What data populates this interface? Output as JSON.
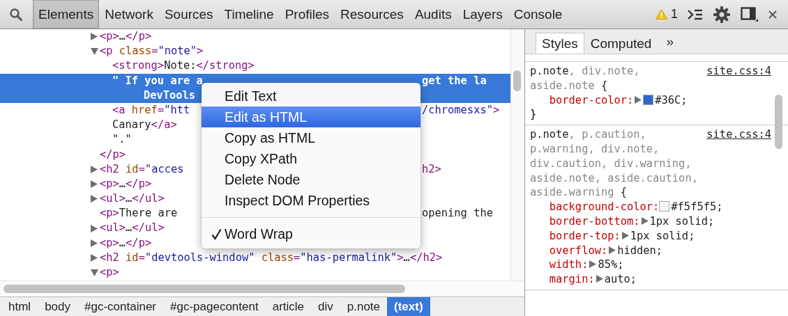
{
  "toolbar": {
    "tabs": [
      {
        "label": "Elements",
        "selected": true
      },
      {
        "label": "Network",
        "selected": false
      },
      {
        "label": "Sources",
        "selected": false
      },
      {
        "label": "Timeline",
        "selected": false
      },
      {
        "label": "Profiles",
        "selected": false
      },
      {
        "label": "Resources",
        "selected": false
      },
      {
        "label": "Audits",
        "selected": false
      },
      {
        "label": "Layers",
        "selected": false
      },
      {
        "label": "Console",
        "selected": false
      }
    ],
    "warning_count": "1"
  },
  "elements": {
    "nodes": [
      {
        "kind": "element",
        "expanded": false,
        "selected": false,
        "rows": [
          {
            "parts": [
              {
                "kind": "tag",
                "t": "<p>"
              },
              {
                "kind": "txt",
                "t": "…"
              },
              {
                "kind": "tag",
                "t": "</p>"
              }
            ]
          }
        ]
      },
      {
        "kind": "element",
        "expanded": true,
        "selected": false,
        "rows": [
          {
            "parts": [
              {
                "kind": "tag",
                "t": "<p "
              },
              {
                "kind": "attr",
                "t": "class"
              },
              {
                "kind": "tag",
                "t": "="
              },
              {
                "kind": "val",
                "t": "\"note\""
              },
              {
                "kind": "tag",
                "t": ">"
              }
            ]
          }
        ],
        "children": [
          {
            "kind": "inline",
            "selected": false,
            "rows": [
              {
                "parts": [
                  {
                    "kind": "tag",
                    "t": "<strong>"
                  },
                  {
                    "kind": "txt",
                    "t": "Note:"
                  },
                  {
                    "kind": "tag",
                    "t": "</strong>"
                  }
                ]
              }
            ]
          },
          {
            "kind": "text",
            "selected": true,
            "rows": [
              {
                "parts": [
                  {
                    "kind": "txt",
                    "t": "\" If you are a"
                  }
                ],
                "resume": [
                  {
                    "kind": "txt",
                    "t": "get the la"
                  }
                ]
              },
              {
                "parts": [
                  {
                    "kind": "txt",
                    "t": "DevTools"
                  }
                ]
              }
            ]
          },
          {
            "kind": "inline",
            "selected": false,
            "rows": [
              {
                "parts": [
                  {
                    "kind": "tag",
                    "t": "<a "
                  },
                  {
                    "kind": "attr",
                    "t": "href"
                  },
                  {
                    "kind": "tag",
                    "t": "="
                  },
                  {
                    "kind": "val",
                    "t": "\"htt"
                  }
                ],
                "resume": [
                  {
                    "kind": "val",
                    "t": "/chromesxs\""
                  },
                  {
                    "kind": "tag",
                    "t": ">"
                  }
                ]
              },
              {
                "parts": [
                  {
                    "kind": "txt",
                    "t": "Canary"
                  },
                  {
                    "kind": "tag",
                    "t": "</a>"
                  }
                ]
              }
            ]
          },
          {
            "kind": "text",
            "selected": false,
            "rows": [
              {
                "parts": [
                  {
                    "kind": "txt",
                    "t": "\".\""
                  }
                ]
              }
            ]
          }
        ],
        "closing": [
          {
            "parts": [
              {
                "kind": "tag",
                "t": "</p>"
              }
            ]
          }
        ]
      },
      {
        "kind": "element",
        "expanded": false,
        "selected": false,
        "rows": [
          {
            "parts": [
              {
                "kind": "tag",
                "t": "<h2 "
              },
              {
                "kind": "attr",
                "t": "id"
              },
              {
                "kind": "tag",
                "t": "="
              },
              {
                "kind": "val",
                "t": "\"acces"
              }
            ],
            "resume": [
              {
                "kind": "tag",
                "t": "h2>"
              }
            ]
          }
        ]
      },
      {
        "kind": "element",
        "expanded": false,
        "selected": false,
        "rows": [
          {
            "parts": [
              {
                "kind": "tag",
                "t": "<p>"
              },
              {
                "kind": "txt",
                "t": "…"
              },
              {
                "kind": "tag",
                "t": "</p>"
              }
            ]
          }
        ]
      },
      {
        "kind": "element",
        "expanded": false,
        "selected": false,
        "rows": [
          {
            "parts": [
              {
                "kind": "tag",
                "t": "<ul>"
              },
              {
                "kind": "txt",
                "t": "…"
              },
              {
                "kind": "tag",
                "t": "</ul>"
              }
            ]
          }
        ]
      },
      {
        "kind": "inline",
        "selected": false,
        "rows": [
          {
            "parts": [
              {
                "kind": "tag",
                "t": "<p>"
              },
              {
                "kind": "txt",
                "t": "There are"
              }
            ],
            "resume": [
              {
                "kind": "txt",
                "t": "opening the"
              }
            ]
          }
        ]
      },
      {
        "kind": "element",
        "expanded": false,
        "selected": false,
        "rows": [
          {
            "parts": [
              {
                "kind": "tag",
                "t": "<ul>"
              },
              {
                "kind": "txt",
                "t": "…"
              },
              {
                "kind": "tag",
                "t": "</ul>"
              }
            ]
          }
        ]
      },
      {
        "kind": "element",
        "expanded": false,
        "selected": false,
        "rows": [
          {
            "parts": [
              {
                "kind": "tag",
                "t": "<p>"
              },
              {
                "kind": "txt",
                "t": "…"
              },
              {
                "kind": "tag",
                "t": "</p>"
              }
            ]
          }
        ]
      },
      {
        "kind": "element",
        "expanded": false,
        "selected": false,
        "rows": [
          {
            "parts": [
              {
                "kind": "tag",
                "t": "<h2 "
              },
              {
                "kind": "attr",
                "t": "id"
              },
              {
                "kind": "tag",
                "t": "="
              },
              {
                "kind": "val",
                "t": "\"devtools-window\""
              },
              {
                "kind": "attr",
                "t": " class"
              },
              {
                "kind": "tag",
                "t": "="
              },
              {
                "kind": "val",
                "t": "\"has-permalink\""
              },
              {
                "kind": "tag",
                "t": ">"
              },
              {
                "kind": "txt",
                "t": "…"
              },
              {
                "kind": "tag",
                "t": "</h2>"
              }
            ]
          }
        ]
      },
      {
        "kind": "element",
        "expanded": true,
        "selected": false,
        "rows": [
          {
            "parts": [
              {
                "kind": "tag",
                "t": "<p>"
              }
            ]
          }
        ]
      }
    ]
  },
  "context_menu": {
    "items": [
      {
        "kind": "item",
        "label": "Edit Text",
        "selected": false,
        "checked": false
      },
      {
        "kind": "item",
        "label": "Edit as HTML",
        "selected": true,
        "checked": false
      },
      {
        "kind": "item",
        "label": "Copy as HTML",
        "selected": false,
        "checked": false
      },
      {
        "kind": "item",
        "label": "Copy XPath",
        "selected": false,
        "checked": false
      },
      {
        "kind": "item",
        "label": "Delete Node",
        "selected": false,
        "checked": false
      },
      {
        "kind": "item",
        "label": "Inspect DOM Properties",
        "selected": false,
        "checked": false
      },
      {
        "kind": "separator"
      },
      {
        "kind": "item",
        "label": "Word Wrap",
        "selected": false,
        "checked": true
      }
    ]
  },
  "breadcrumbs": [
    {
      "label": "html",
      "selected": false
    },
    {
      "label": "body",
      "selected": false
    },
    {
      "label": "#gc-container",
      "selected": false
    },
    {
      "label": "#gc-pagecontent",
      "selected": false
    },
    {
      "label": "article",
      "selected": false
    },
    {
      "label": "div",
      "selected": false
    },
    {
      "label": "p.note",
      "selected": false
    },
    {
      "label": "(text)",
      "selected": true
    }
  ],
  "sidebar": {
    "tabs": [
      {
        "label": "Styles",
        "selected": true
      },
      {
        "label": "Computed",
        "selected": false
      }
    ],
    "more": "»",
    "rules": [
      {
        "selector": [
          {
            "t": "p.note",
            "matched": true
          },
          {
            "t": ", div.note, aside.note",
            "matched": false
          }
        ],
        "open": "{",
        "source": "site.css:4",
        "props": [
          {
            "name": "border-color:",
            "expandable": true,
            "color": "#3366cc",
            "value": "#36C;"
          }
        ],
        "close": "}"
      },
      {
        "selector": [
          {
            "t": "p.note",
            "matched": true
          },
          {
            "t": ", p.caution, p.warning, div.note, div.caution, div.warning, aside.note, aside.caution, aside.warning",
            "matched": false
          }
        ],
        "open": "{",
        "source": "site.css:4",
        "props": [
          {
            "name": "background-color:",
            "expandable": false,
            "color": "#f5f5f5",
            "value": "#f5f5f5;"
          },
          {
            "name": "border-bottom:",
            "expandable": true,
            "value": "1px solid;"
          },
          {
            "name": "border-top:",
            "expandable": true,
            "value": "1px solid;"
          },
          {
            "name": "overflow:",
            "expandable": true,
            "value": "hidden;"
          },
          {
            "name": "width:",
            "expandable": true,
            "value": "85%;"
          },
          {
            "name": "margin:",
            "expandable": true,
            "value": "auto;"
          }
        ]
      }
    ]
  }
}
